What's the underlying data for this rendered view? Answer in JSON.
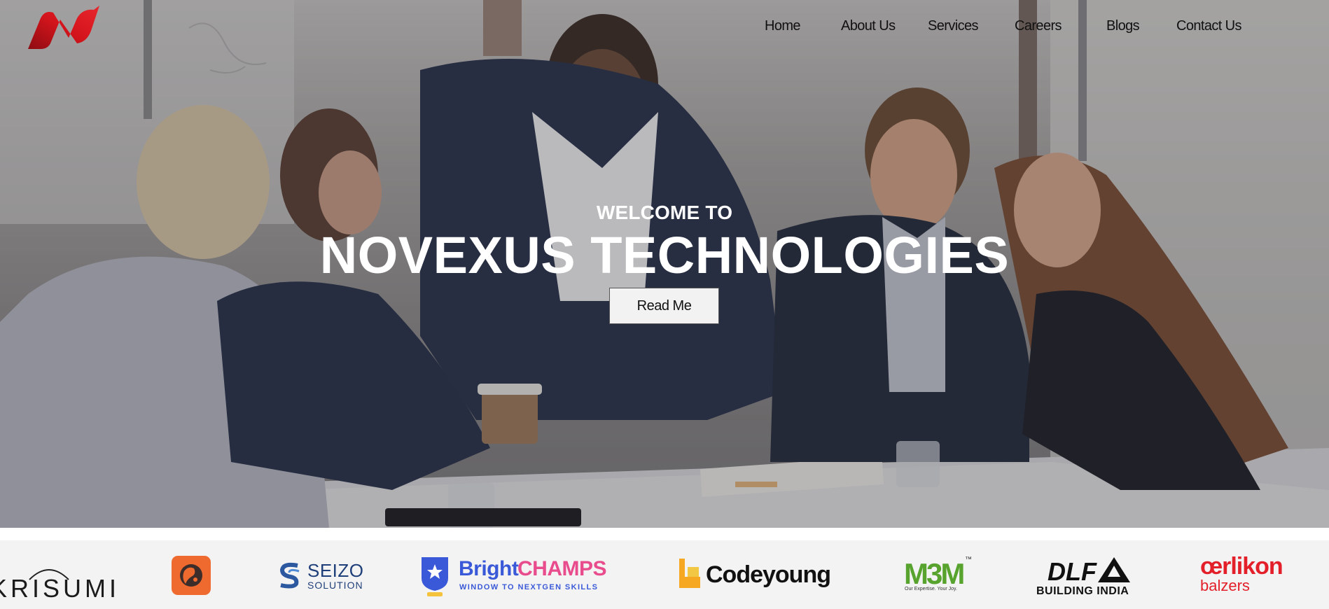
{
  "header": {
    "logo_name": "novexus-logo",
    "nav": [
      {
        "label": "Home"
      },
      {
        "label": "About Us"
      },
      {
        "label": "Services"
      },
      {
        "label": "Careers"
      },
      {
        "label": "Blogs"
      },
      {
        "label": "Contact Us"
      }
    ]
  },
  "hero": {
    "welcome": "WELCOME TO",
    "title": "NOVEXUS TECHNOLOGIES",
    "cta_label": "Read Me"
  },
  "clients": [
    {
      "name": "KRISUMI",
      "text": "KRISUMI"
    },
    {
      "name": "orange-globe-logo",
      "text": ""
    },
    {
      "name": "SEIZO SOLUTION",
      "text_top": "SEIZO",
      "text_bottom": "SOLUTION"
    },
    {
      "name": "BrightCHAMPS",
      "text_a": "Bright",
      "text_b": "CHAMPS",
      "tagline": "WINDOW TO NEXTGEN SKILLS"
    },
    {
      "name": "Codeyoung",
      "text": "Codeyoung"
    },
    {
      "name": "M3M",
      "text": "M3M",
      "tm": "™",
      "tagline": "Our Expertise. Your Joy."
    },
    {
      "name": "DLF",
      "text": "DLF",
      "tagline": "BUILDING INDIA"
    },
    {
      "name": "oerlikon balzers",
      "text_top": "œrlikon",
      "text_bottom": "balzers"
    }
  ],
  "colors": {
    "brand_red": "#d4141c",
    "nav_text": "#111111",
    "hero_text": "#ffffff",
    "strip_bg": "#f3f3f3"
  }
}
